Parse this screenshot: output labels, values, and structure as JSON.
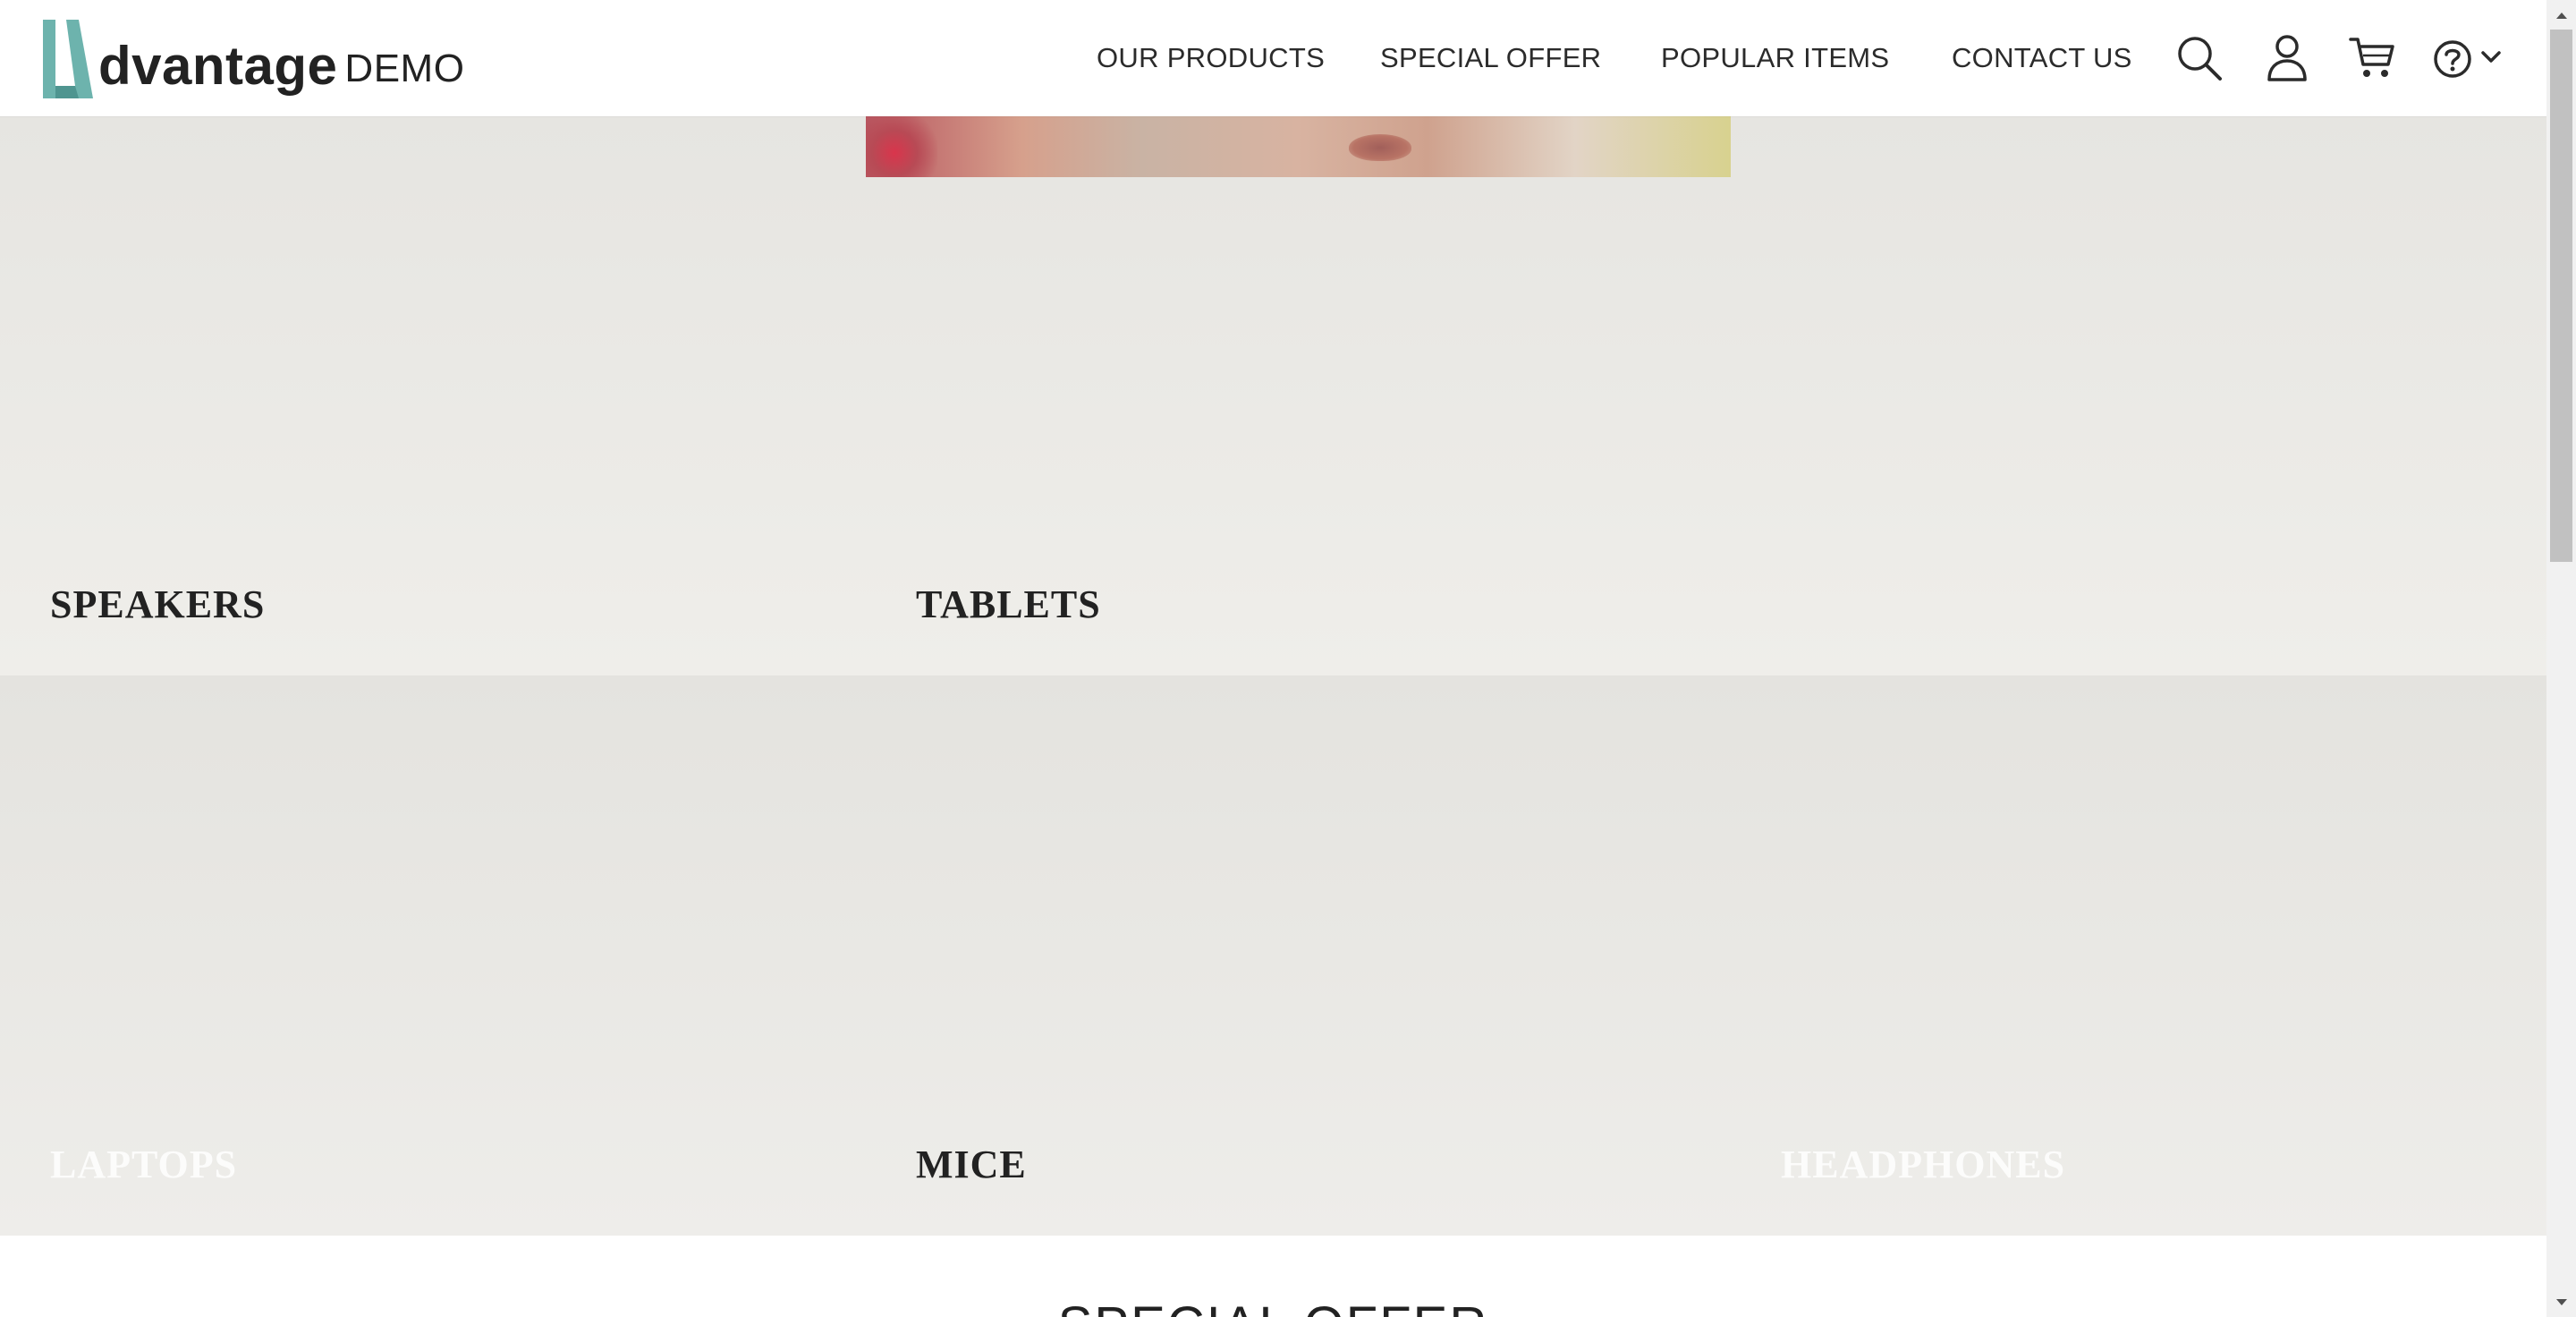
{
  "brand": {
    "word": "dvantage",
    "suffix": "DEMO",
    "accent_color": "#5fa9a5"
  },
  "nav": {
    "our_products": "OUR PRODUCTS",
    "special_offer": "SPECIAL OFFER",
    "popular_items": "POPULAR ITEMS",
    "contact_us": "CONTACT US"
  },
  "header_icons": [
    "search-icon",
    "user-icon",
    "cart-icon",
    "help-icon",
    "chevron-down-icon"
  ],
  "categories": {
    "speakers": "SPEAKERS",
    "tablets": "TABLETS",
    "laptops": "LAPTOPS",
    "mice": "MICE",
    "headphones": "HEADPHONES"
  },
  "sections": {
    "special_offer_title": "SPECIAL OFFER"
  }
}
